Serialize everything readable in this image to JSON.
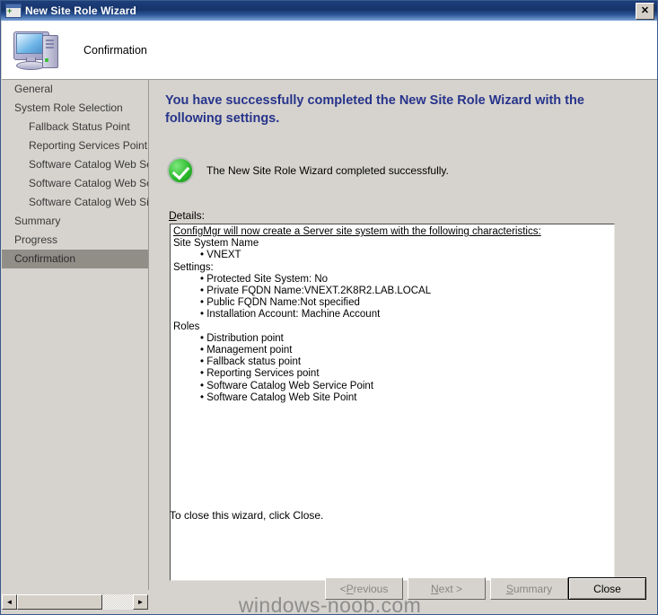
{
  "window": {
    "title": "New Site Role Wizard",
    "title_icon": "wizard-window-icon",
    "close_glyph": "✕"
  },
  "banner": {
    "icon": "computer-site-system-icon",
    "title": "Confirmation"
  },
  "sidebar": {
    "items": [
      {
        "label": "General",
        "indent": false,
        "current": false
      },
      {
        "label": "System Role Selection",
        "indent": false,
        "current": false
      },
      {
        "label": "Fallback Status Point",
        "indent": true,
        "current": false
      },
      {
        "label": "Reporting Services Point",
        "indent": true,
        "current": false
      },
      {
        "label": "Software Catalog Web Service Point",
        "indent": true,
        "current": false
      },
      {
        "label": "Software Catalog Web Service Point",
        "indent": true,
        "current": false
      },
      {
        "label": "Software Catalog Web Site Point",
        "indent": true,
        "current": false
      },
      {
        "label": "Summary",
        "indent": false,
        "current": false
      },
      {
        "label": "Progress",
        "indent": false,
        "current": false
      },
      {
        "label": "Confirmation",
        "indent": false,
        "current": true
      }
    ],
    "scrollbar": {
      "left_arrow": "◄",
      "right_arrow": "►"
    }
  },
  "main": {
    "heading": "You have successfully completed the New Site Role Wizard with the following settings.",
    "success_icon": "green-check-circle-icon",
    "success_text": "The New Site Role Wizard completed successfully.",
    "details_label_accesskey": "D",
    "details_label_rest": "etails:",
    "details_lines": [
      {
        "text": "ConfigMgr will now create a Server site system with the following characteristics:",
        "bullet": false,
        "underline": true
      },
      {
        "text": "Site System Name",
        "bullet": false,
        "underline": false
      },
      {
        "text": "• VNEXT",
        "bullet": true,
        "underline": false
      },
      {
        "text": "Settings:",
        "bullet": false,
        "underline": false
      },
      {
        "text": "• Protected Site System: No",
        "bullet": true,
        "underline": false
      },
      {
        "text": "• Private FQDN Name:VNEXT.2K8R2.LAB.LOCAL",
        "bullet": true,
        "underline": false
      },
      {
        "text": "• Public FQDN Name:Not specified",
        "bullet": true,
        "underline": false
      },
      {
        "text": "• Installation Account: Machine Account",
        "bullet": true,
        "underline": false
      },
      {
        "text": "Roles",
        "bullet": false,
        "underline": false
      },
      {
        "text": "• Distribution point",
        "bullet": true,
        "underline": false
      },
      {
        "text": "• Management point",
        "bullet": true,
        "underline": false
      },
      {
        "text": "• Fallback status point",
        "bullet": true,
        "underline": false
      },
      {
        "text": "• Reporting Services point",
        "bullet": true,
        "underline": false
      },
      {
        "text": "• Software Catalog Web Service Point",
        "bullet": true,
        "underline": false
      },
      {
        "text": "• Software Catalog Web Site Point",
        "bullet": true,
        "underline": false
      }
    ],
    "close_hint": "To close this wizard, click Close."
  },
  "footer": {
    "previous_prefix": "< ",
    "previous_accesskey": "P",
    "previous_rest": "revious",
    "next_accesskey": "N",
    "next_rest": "ext >",
    "summary_accesskey": "S",
    "summary_rest": "ummary",
    "close_label": "Close"
  },
  "watermark": "windows-noob.com",
  "colors": {
    "titlebar_blue": "#1d3f7a",
    "heading_blue": "#27348b",
    "dialog_face": "#d6d3ce",
    "selection_gray": "#918e88",
    "success_green": "#2fbb2f"
  }
}
